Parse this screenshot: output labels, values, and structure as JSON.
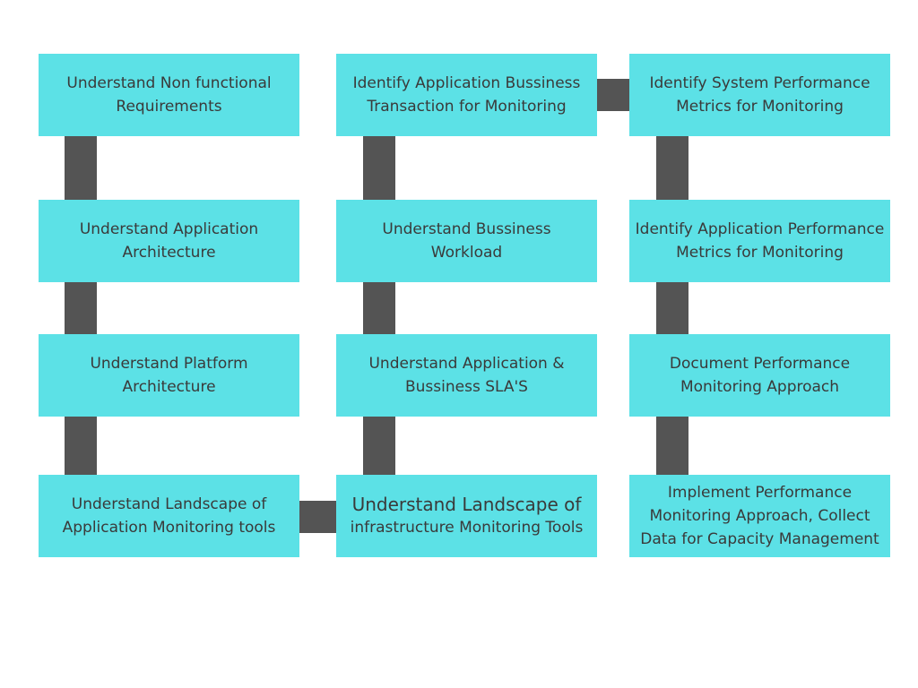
{
  "colors": {
    "box": "#5ce1e6",
    "connector": "#545454",
    "text": "#3a3a3a"
  },
  "steps": {
    "c1r1": [
      "Understand Non functional",
      "Requirements"
    ],
    "c1r2": [
      "Understand Application",
      "Architecture"
    ],
    "c1r3": [
      "Understand Platform",
      "Architecture"
    ],
    "c1r4": [
      "Understand Landscape of",
      "Application Monitoring tools"
    ],
    "c2r1": [
      "Identify Application Bussiness",
      "Transaction for Monitoring"
    ],
    "c2r2": [
      "Understand Bussiness",
      "Workload"
    ],
    "c2r3": [
      "Understand Application &",
      "Bussiness SLA'S"
    ],
    "c2r4": [
      "Understand Landscape of",
      "infrastructure Monitoring Tools"
    ],
    "c3r1": [
      "Identify System Performance",
      "Metrics for Monitoring"
    ],
    "c3r2": [
      "Identify Application Performance",
      "Metrics for Monitoring"
    ],
    "c3r3": [
      "Document Performance",
      "Monitoring Approach"
    ],
    "c3r4": [
      "Implement Performance",
      "Monitoring Approach, Collect",
      "Data for Capacity Management"
    ]
  }
}
